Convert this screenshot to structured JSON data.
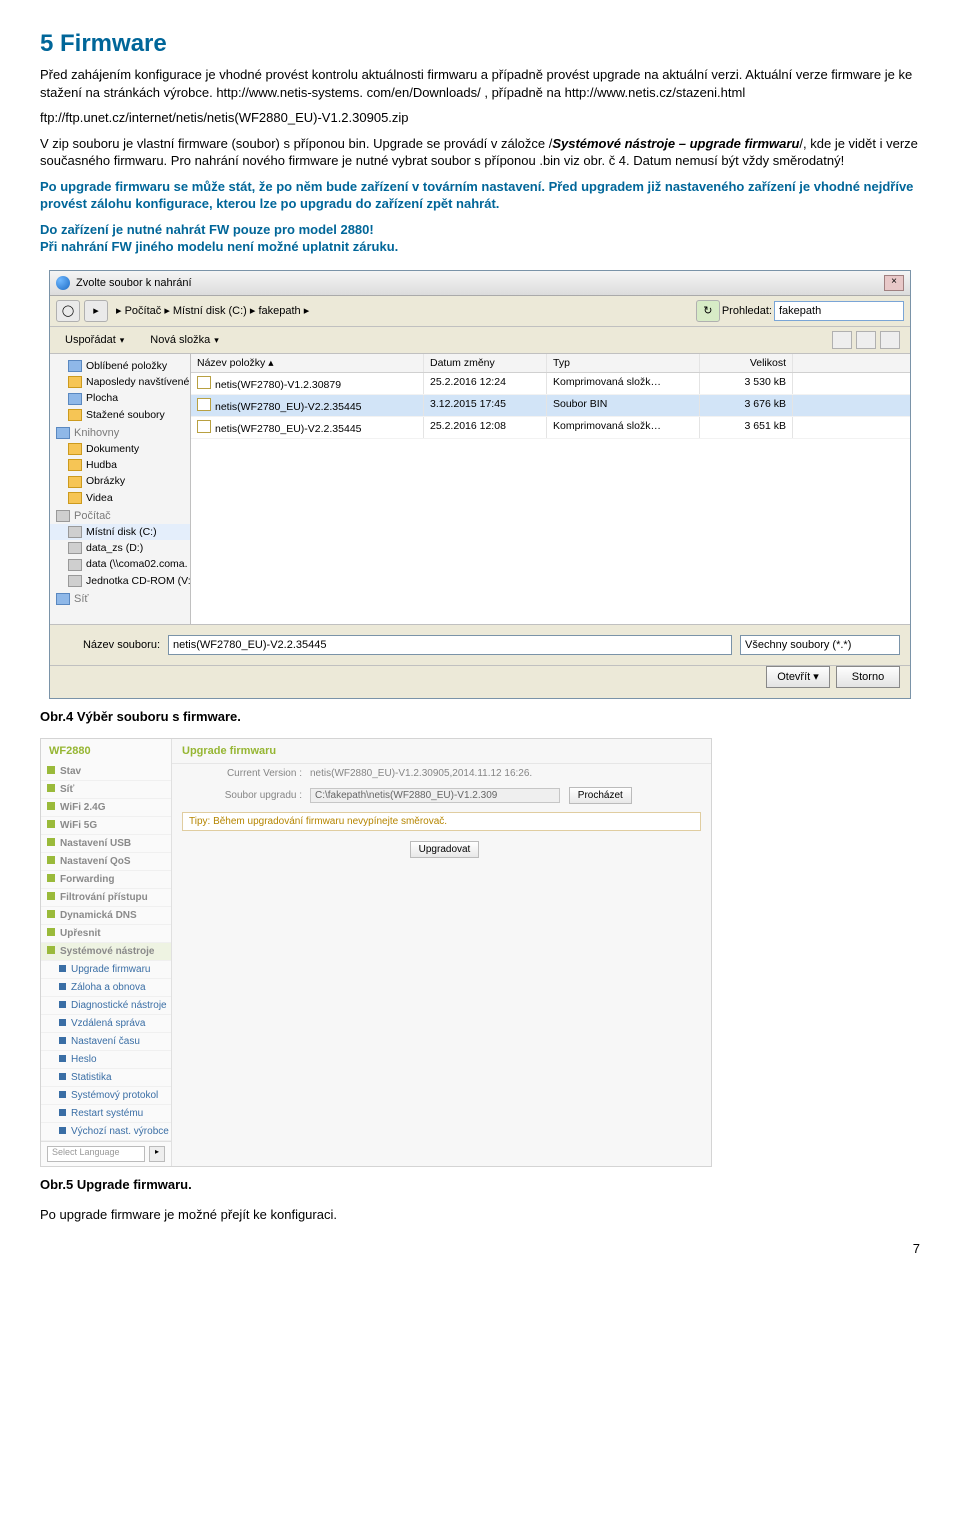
{
  "doc": {
    "h1": "5 Firmware",
    "p1": "Před zahájením konfigurace je vhodné provést kontrolu aktuálnosti firmwaru a případně provést upgrade na aktuální verzi. Aktuální verze firmware je ke stažení na stránkách výrobce. http://www.netis-systems. com/en/Downloads/ , případně na http://www.netis.cz/stazeni.html",
    "p2": "ftp://ftp.unet.cz/internet/netis/netis(WF2880_EU)-V1.2.30905.zip",
    "p3a": "V zip souboru je vlastní firmware (soubor) s příponou bin. Upgrade se provádí v záložce /",
    "p3i": "Systémové nástroje – upgrade firmwaru",
    "p3b": "/, kde je vidět i verze současného firmwaru. Pro nahrání nového firmware je nutné vybrat soubor s příponou .bin viz obr. č 4. Datum nemusí být vždy směrodatný!",
    "p4": "Po upgrade firmwaru se může stát, že po něm bude zařízení v továrním nastavení. Před upgradem již nastaveného zařízení je vhodné nejdříve provést zálohu konfigurace, kterou lze po upgradu do zařízení zpět nahrát.",
    "p5": "Do zařízení je nutné nahrát FW pouze pro model 2880!",
    "p6": "Při nahrání FW jiného modelu není možné uplatnit záruku.",
    "cap4": "Obr.4  Výběr souboru s firmware.",
    "cap5": "Obr.5  Upgrade firmwaru.",
    "p7": "Po upgrade firmware je možné přejít ke konfiguraci.",
    "pagenum": "7"
  },
  "dialog": {
    "title": "Zvolte soubor k nahrání",
    "breadcrumb": " ▸ Počítač ▸ Místní disk (C:) ▸ fakepath ▸",
    "search_label": "Prohledat:",
    "search_val": "fakepath",
    "toolbar_a": "Uspořádat",
    "toolbar_b": "Nová složka",
    "side": {
      "fav": "Oblíbené položky",
      "recent": "Naposledy navštívené...",
      "desktop": "Plocha",
      "downloads": "Stažené soubory",
      "libs": "Knihovny",
      "docs": "Dokumenty",
      "music": "Hudba",
      "pics": "Obrázky",
      "video": "Videa",
      "pc": "Počítač",
      "cdisk": "Místní disk (C:)",
      "ddisk": "data_zs (D:)",
      "netd": "data (\\\\coma02.coma.",
      "cdrom": "Jednotka CD-ROM (V:)",
      "net": "Síť"
    },
    "cols": {
      "name": "Název položky",
      "date": "Datum změny",
      "type": "Typ",
      "size": "Velikost"
    },
    "rows": [
      {
        "name": "netis(WF2780)-V1.2.30879",
        "date": "25.2.2016 12:24",
        "type": "Komprimovaná složk…",
        "size": "3 530 kB"
      },
      {
        "name": "netis(WF2780_EU)-V2.2.35445",
        "date": "3.12.2015 17:45",
        "type": "Soubor BIN",
        "size": "3 676 kB"
      },
      {
        "name": "netis(WF2780_EU)-V2.2.35445",
        "date": "25.2.2016 12:08",
        "type": "Komprimovaná složk…",
        "size": "3 651 kB"
      }
    ],
    "fn_label": "Název souboru:",
    "fn_value": "netis(WF2780_EU)-V2.2.35445",
    "filter": "Všechny soubory (*.*)",
    "open": "Otevřít",
    "cancel": "Storno"
  },
  "router": {
    "model": "WF2880",
    "nav": [
      "Stav",
      "Síť",
      "WiFi 2.4G",
      "WiFi 5G",
      "Nastavení USB",
      "Nastavení QoS",
      "Forwarding",
      "Filtrování přístupu",
      "Dynamická DNS",
      "Upřesnit"
    ],
    "systools": "Systémové nástroje",
    "subs": [
      "Upgrade firmwaru",
      "Záloha a obnova",
      "Diagnostické nástroje",
      "Vzdálená správa",
      "Nastavení času",
      "Heslo",
      "Statistika",
      "Systémový protokol",
      "Restart systému",
      "Výchozí nast. výrobce"
    ],
    "sel": "Select Language",
    "title": "Upgrade firmwaru",
    "cv_k": "Current Version :",
    "cv_v": "netis(WF2880_EU)-V1.2.30905,2014.11.12 16:26.",
    "su_k": "Soubor upgradu :",
    "su_v": "C:\\fakepath\\netis(WF2880_EU)-V1.2.309",
    "browse": "Procházet",
    "tip": "Tipy: Během upgradování firmwaru nevypínejte směrovač.",
    "upgbtn": "Upgradovat"
  }
}
